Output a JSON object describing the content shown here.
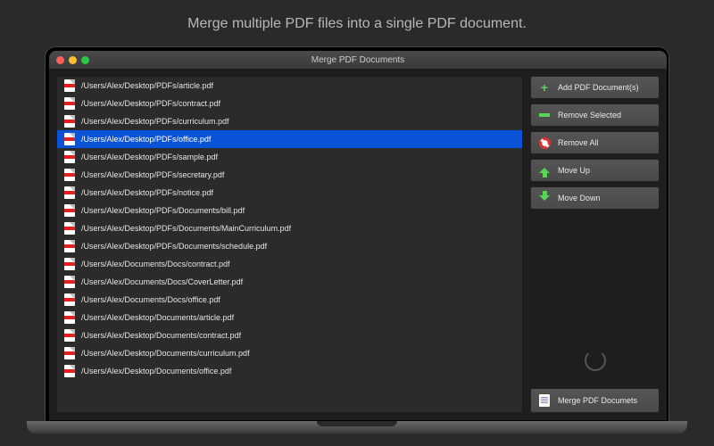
{
  "tagline": "Merge multiple PDF files into a single PDF document.",
  "window": {
    "title": "Merge PDF Documents"
  },
  "files": [
    {
      "path": "/Users/Alex/Desktop/PDFs/article.pdf",
      "selected": false
    },
    {
      "path": "/Users/Alex/Desktop/PDFs/contract.pdf",
      "selected": false
    },
    {
      "path": "/Users/Alex/Desktop/PDFs/curriculum.pdf",
      "selected": false
    },
    {
      "path": "/Users/Alex/Desktop/PDFs/office.pdf",
      "selected": true
    },
    {
      "path": "/Users/Alex/Desktop/PDFs/sample.pdf",
      "selected": false
    },
    {
      "path": "/Users/Alex/Desktop/PDFs/secretary.pdf",
      "selected": false
    },
    {
      "path": "/Users/Alex/Desktop/PDFs/notice.pdf",
      "selected": false
    },
    {
      "path": "/Users/Alex/Desktop/PDFs/Documents/bill.pdf",
      "selected": false
    },
    {
      "path": "/Users/Alex/Desktop/PDFs/Documents/MainCurriculum.pdf",
      "selected": false
    },
    {
      "path": "/Users/Alex/Desktop/PDFs/Documents/schedule.pdf",
      "selected": false
    },
    {
      "path": "/Users/Alex/Documents/Docs/contract.pdf",
      "selected": false
    },
    {
      "path": "/Users/Alex/Documents/Docs/CoverLetter.pdf",
      "selected": false
    },
    {
      "path": "/Users/Alex/Documents/Docs/office.pdf",
      "selected": false
    },
    {
      "path": "/Users/Alex/Desktop/Documents/article.pdf",
      "selected": false
    },
    {
      "path": "/Users/Alex/Desktop/Documents/contract.pdf",
      "selected": false
    },
    {
      "path": "/Users/Alex/Desktop/Documents/curriculum.pdf",
      "selected": false
    },
    {
      "path": "/Users/Alex/Desktop/Documents/office.pdf",
      "selected": false
    }
  ],
  "buttons": {
    "add": "Add PDF Document(s)",
    "remove_selected": "Remove Selected",
    "remove_all": "Remove All",
    "move_up": "Move Up",
    "move_down": "Move Down",
    "merge": "Merge PDF Documets"
  }
}
